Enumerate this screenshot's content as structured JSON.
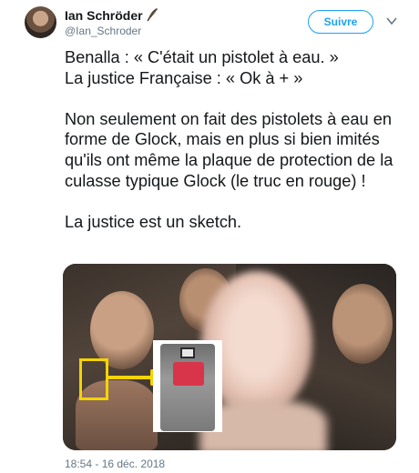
{
  "tweet": {
    "author": {
      "display_name": "Ian Schröder",
      "handle": "@Ian_Schroder",
      "avatar_icon": "user-avatar-photo",
      "name_emoji": "quill-pen-emoji"
    },
    "follow_label": "Suivre",
    "text": "Benalla : « C'était un pistolet à eau. »\nLa justice Française : « Ok à + »\n\nNon seulement on fait des pistolets à eau en forme de Glock, mais en plus si bien imités qu'ils ont même la plaque de protection de la culasse typique Glock (le truc en rouge) !\n\nLa justice est un sketch.",
    "media": {
      "kind": "photo",
      "highlight_color": "#f5d400",
      "plate_color": "#d8344a"
    },
    "timestamp": "18:54 - 16 déc. 2018"
  },
  "colors": {
    "accent": "#1da1f2",
    "text": "#14171a",
    "secondary": "#657786"
  }
}
